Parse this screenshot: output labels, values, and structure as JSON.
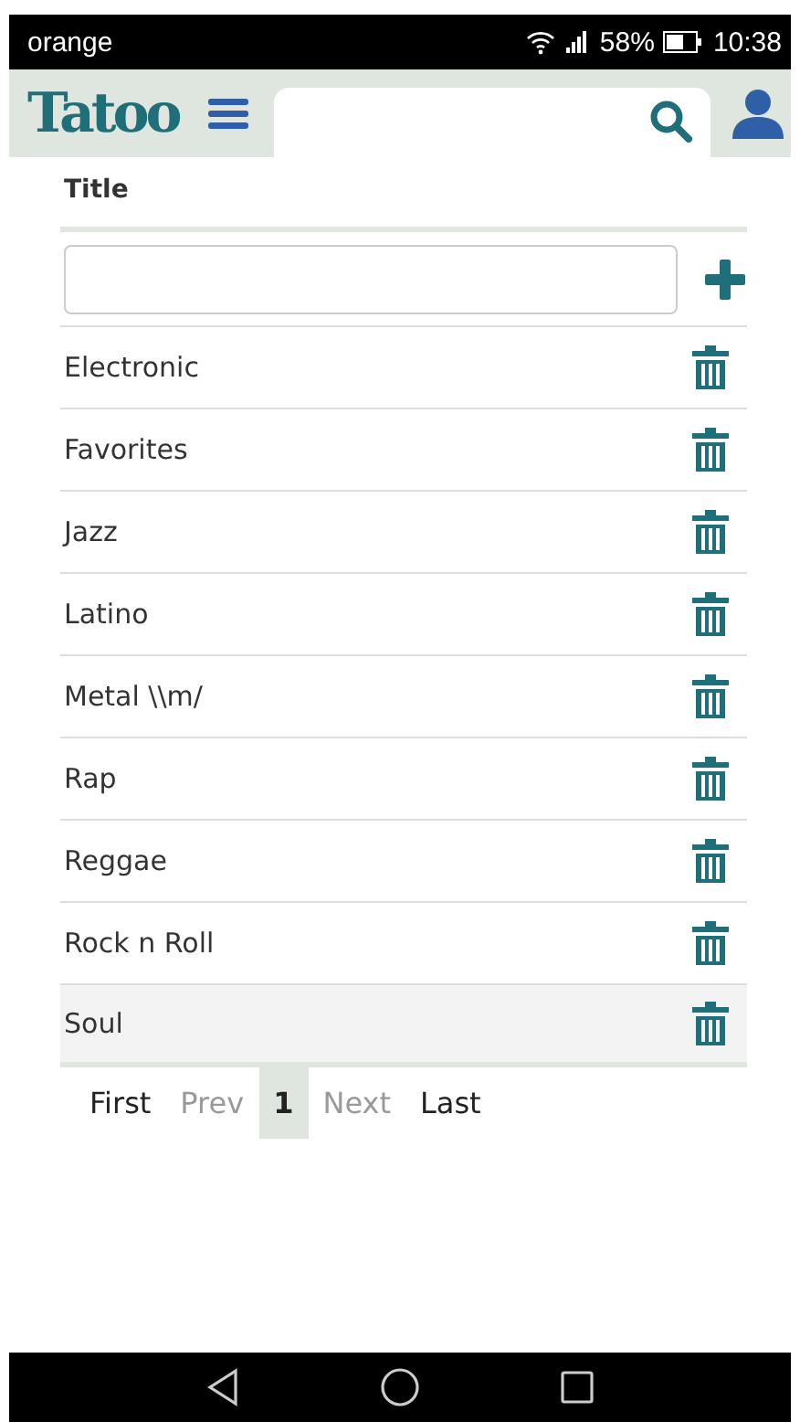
{
  "status_bar": {
    "carrier": "orange",
    "battery": "58%",
    "time": "10:38"
  },
  "header": {
    "logo": "Tatoo"
  },
  "table": {
    "column": "Title",
    "rows": [
      {
        "title": "Electronic",
        "selected": false
      },
      {
        "title": "Favorites",
        "selected": false
      },
      {
        "title": "Jazz",
        "selected": false
      },
      {
        "title": "Latino",
        "selected": false
      },
      {
        "title": "Metal \\\\m/",
        "selected": false
      },
      {
        "title": "Rap",
        "selected": false
      },
      {
        "title": "Reggae",
        "selected": false
      },
      {
        "title": "Rock n Roll",
        "selected": false
      },
      {
        "title": "Soul",
        "selected": true
      }
    ]
  },
  "pagination": [
    {
      "label": "First",
      "disabled": false,
      "selected": false
    },
    {
      "label": "Prev",
      "disabled": true,
      "selected": false
    },
    {
      "label": "1",
      "disabled": false,
      "selected": true
    },
    {
      "label": "Next",
      "disabled": true,
      "selected": false
    },
    {
      "label": "Last",
      "disabled": false,
      "selected": false
    }
  ]
}
